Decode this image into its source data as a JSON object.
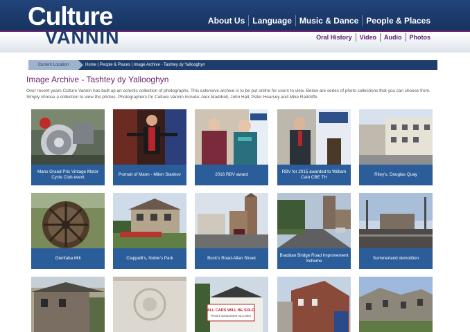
{
  "header": {
    "logo_top": "Culture",
    "logo_bottom": "VANNIN",
    "main_nav": [
      "About Us",
      "Language",
      "Music & Dance",
      "People & Places"
    ],
    "sub_nav": [
      "Oral History",
      "Video",
      "Audio",
      "Photos"
    ]
  },
  "breadcrumb": {
    "label": "Current Location",
    "path": "Home | People & Places | Image Archive - Tashtey dy Yallooghyn"
  },
  "page": {
    "title": "Image Archive - Tashtey dy Yallooghyn",
    "intro": "Over recent years Culture Vannin has built up an eclectic collection of photographs. This extensive archive is to be put online for users to view. Below are series of photo collections that you can choose from. Simply choose a collection to view the photos. Photographers for Culture Vannin include: Alex Maddrell, John Hall, Peter Hearsey and Mike Radcliffe"
  },
  "collections": [
    {
      "caption": "Manx Grand Prix Vintage Motor Cycle Club event",
      "icon": "motorcycle-photo"
    },
    {
      "caption": "Portrait of Mann - Milen Stankov",
      "icon": "performer-photo"
    },
    {
      "caption": "2016 RBV award",
      "icon": "award-photo"
    },
    {
      "caption": "RBV for 2015 awarded to William Cain CBE TH",
      "icon": "speaker-photo"
    },
    {
      "caption": "Riley's, Douglas Quay",
      "icon": "quay-photo"
    },
    {
      "caption": "Glenfaba Mill",
      "icon": "mill-photo"
    },
    {
      "caption": "Clappelli's, Noble's Park",
      "icon": "house-photo"
    },
    {
      "caption": "Buck's Road-Allan Street",
      "icon": "church-photo"
    },
    {
      "caption": "Braddan Bridge Road Improvement Scheme",
      "icon": "road-photo"
    },
    {
      "caption": "Summerland demolition",
      "icon": "demolition-photo"
    }
  ],
  "bottom_row": [
    {
      "icon": "cottage-photo"
    },
    {
      "icon": "ceiling-photo"
    },
    {
      "icon": "sign-photo",
      "sign_line1": "ALL CARS WILL BE SOLD",
      "sign_line2": "PRIVATE MANAGEMENT ALLOWED"
    },
    {
      "icon": "brick-building-photo"
    },
    {
      "icon": "ruin-photo"
    }
  ]
}
